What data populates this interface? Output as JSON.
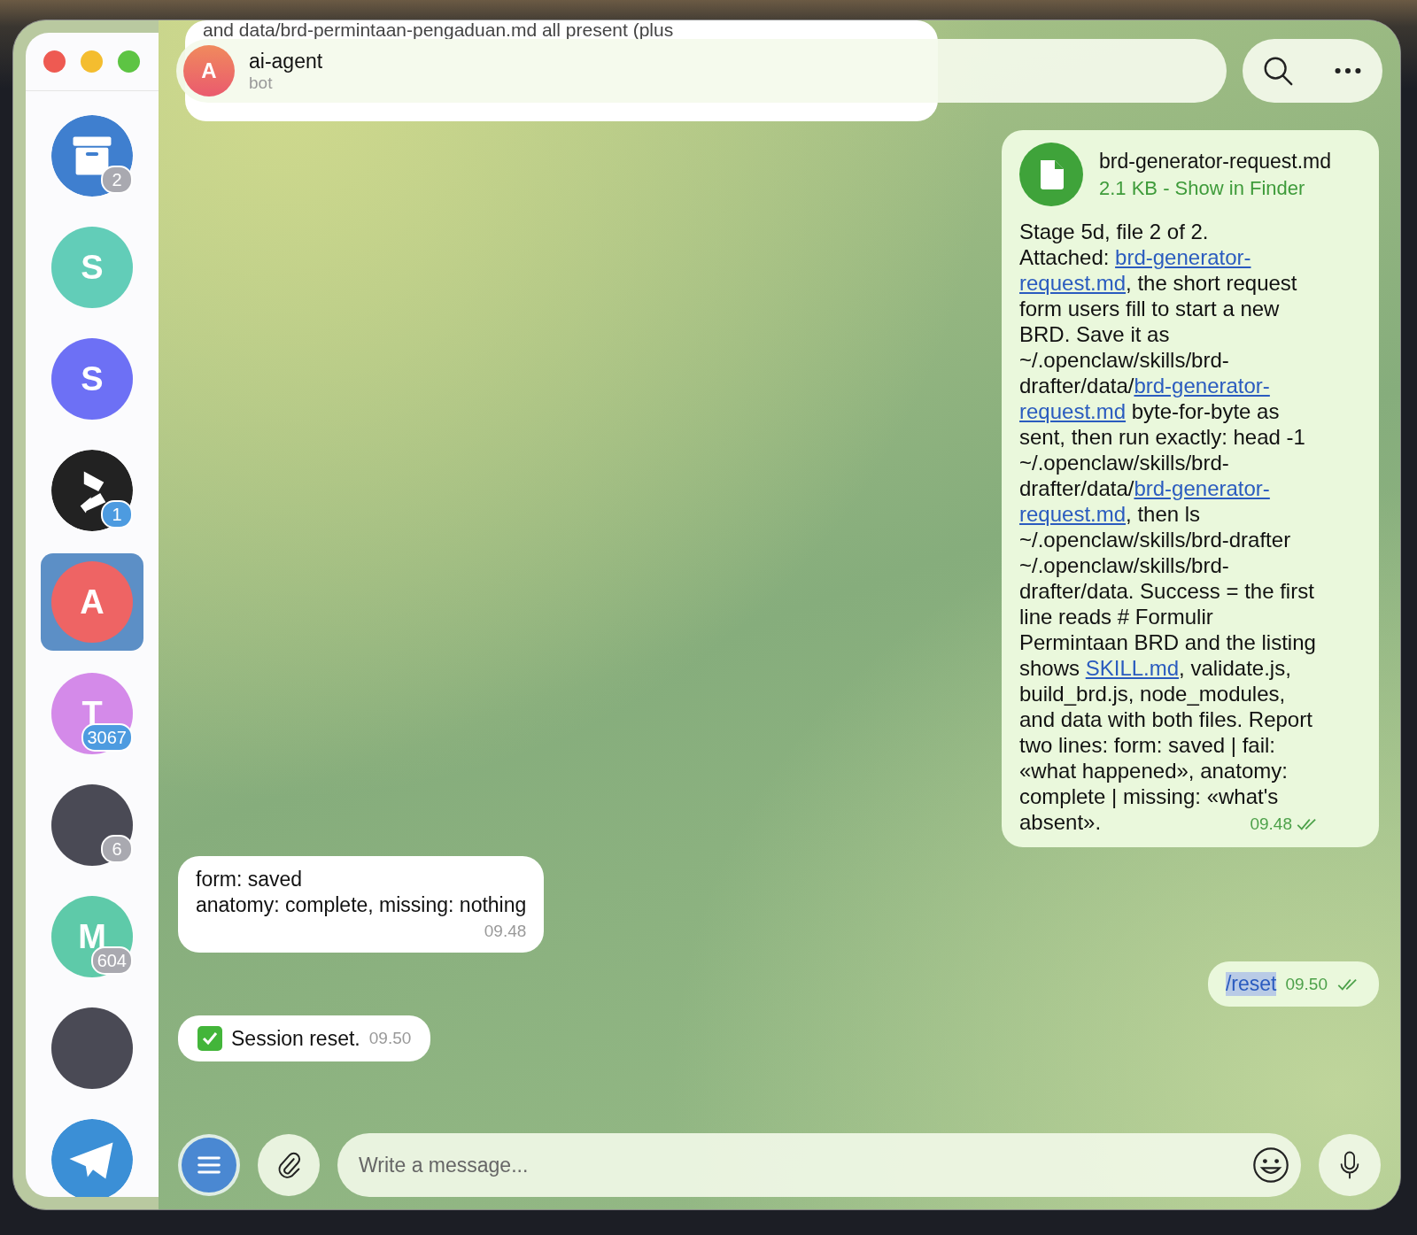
{
  "sidebar": {
    "chats": [
      {
        "kind": "archive",
        "badge": "2",
        "muted": true,
        "selected": false
      },
      {
        "kind": "letter",
        "letter": "S",
        "color": "#62cdb8",
        "selected": false
      },
      {
        "kind": "letter",
        "letter": "S",
        "color": "#6d70f5",
        "selected": false
      },
      {
        "kind": "logo",
        "badge": "1",
        "muted": false,
        "selected": false
      },
      {
        "kind": "letter",
        "letter": "A",
        "color": "#ee6464",
        "selected": true
      },
      {
        "kind": "letter",
        "letter": "T",
        "color": "#d48ae9",
        "badge": "3067",
        "muted": false,
        "selected": false
      },
      {
        "kind": "photo",
        "badge": "6",
        "muted": true,
        "selected": false
      },
      {
        "kind": "letter",
        "letter": "M",
        "color": "#5ecaa9",
        "badge": "604",
        "muted": true,
        "selected": false
      },
      {
        "kind": "photo",
        "selected": false
      },
      {
        "kind": "app",
        "selected": false
      }
    ]
  },
  "header": {
    "avatar_letter": "A",
    "name": "ai-agent",
    "status": "bot"
  },
  "messages": [
    {
      "kind": "partial",
      "text": "and data/brd-permintaan-pengaduan.md all present (plus"
    },
    {
      "kind": "file",
      "file_name": "brd-generator-request.md",
      "file_meta": "2.1  KB - Show in Finder",
      "segments": [
        {
          "kind": "plain",
          "text": "Stage 5d, file 2 of 2.\nAttached: "
        },
        {
          "kind": "link",
          "text": "brd-generator-"
        },
        {
          "kind": "link",
          "text": "request.md"
        },
        {
          "kind": "plain",
          "text": ", the short request form users fill to start a new BRD. Save it as ~/.openclaw/skills/brd-drafter/data/"
        },
        {
          "kind": "link",
          "text": "brd-generator-"
        },
        {
          "kind": "link",
          "text": "request.md"
        },
        {
          "kind": "plain",
          "text": " byte-for-byte as sent, then run exactly: head -1 ~/.openclaw/skills/brd-drafter/data/"
        },
        {
          "kind": "link",
          "text": "brd-generator-"
        },
        {
          "kind": "link",
          "text": "request.md"
        },
        {
          "kind": "plain",
          "text": ", then ls ~/.openclaw/skills/brd-drafter ~/.openclaw/skills/brd-drafter/data. Success = the first line reads # Formulir Permintaan BRD and the listing shows "
        },
        {
          "kind": "link",
          "text": "SKILL.md"
        },
        {
          "kind": "plain",
          "text": ", validate.js, build_brd.js, node_modules, and data with both files. Report two lines: form: saved | fail: «what happened», anatomy: complete | missing: «what's absent»."
        }
      ],
      "time": "09.48",
      "read": true
    },
    {
      "kind": "text",
      "lines": [
        "form: saved",
        "anatomy: complete, missing: nothing"
      ],
      "time": "09.48"
    },
    {
      "kind": "command",
      "text": "/reset",
      "highlighted": true,
      "time": "09.50",
      "read": true
    },
    {
      "kind": "short",
      "check": true,
      "text": "Session reset.",
      "time": "09.50"
    }
  ],
  "composer": {
    "placeholder": "Write a message..."
  }
}
